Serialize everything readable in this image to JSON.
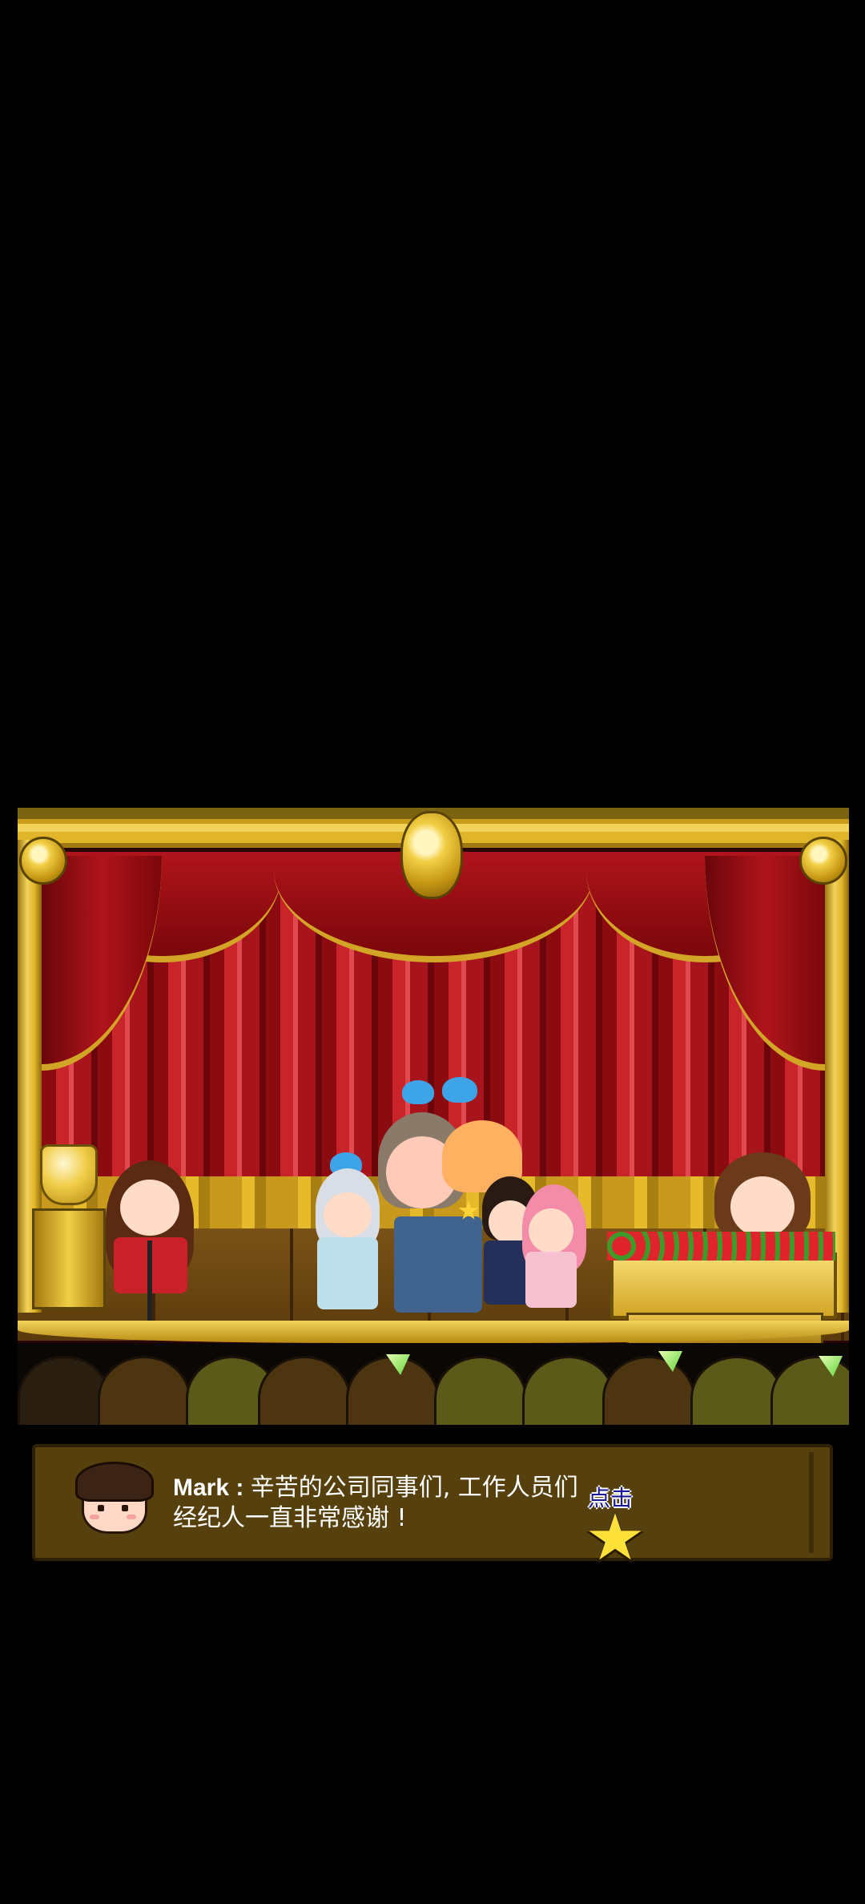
{
  "dialog": {
    "speaker": "Mark",
    "separator": " : ",
    "line1": "辛苦的公司同事们, 工作人员们",
    "line2": "经纪人一直非常感谢 !",
    "tap_label": "点击",
    "tap_icon": "star-icon"
  },
  "colors": {
    "background": "#000000",
    "dialog_bg": "#56400d",
    "curtain_red": "#b0141b",
    "gold": "#e0b52a",
    "star": "#ffe13a",
    "tap_label": "#1b1b9a"
  }
}
